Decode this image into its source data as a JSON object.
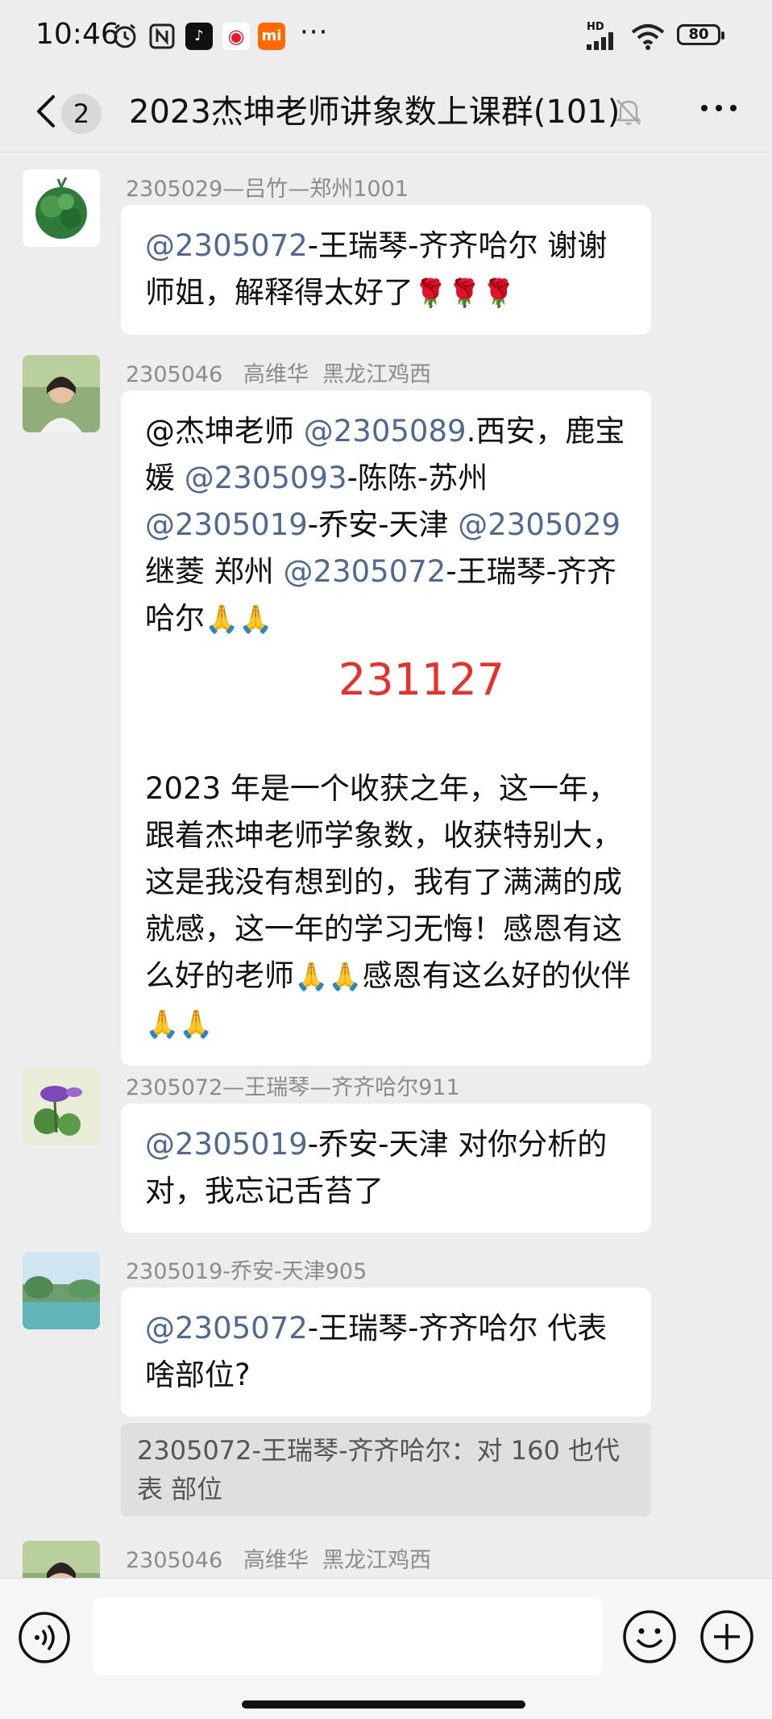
{
  "status_bar": {
    "time": "10:46",
    "app_icons": [
      "alarm-icon",
      "nfc-icon",
      "tiktok-icon",
      "weibo-icon",
      "mi-icon"
    ],
    "more": "···",
    "network": "HD",
    "battery": "80"
  },
  "header": {
    "unread_count": "2",
    "title": "2023杰坤老师讲象数上课群(101)"
  },
  "messages": [
    {
      "sender": "2305029—吕竹—郑州1001",
      "mention": "@2305072",
      "text": "-王瑞琴-齐齐哈尔  谢谢师姐，解释得太好了",
      "emoji": "🌹🌹🌹"
    },
    {
      "sender": "2305046   高维华  黑龙江鸡西",
      "m1_mention": "@杰坤老师",
      "m2_mention": "@2305089",
      "m2_text": ".西安，鹿宝媛",
      "m3_mention": "@2305093",
      "m3_text": "-陈陈-苏州",
      "m4_mention": "@2305019",
      "m4_text": "-乔安-天津",
      "m5_mention": "@2305029",
      "m5_text": "继菱  郑州",
      "m6_mention": "@2305072",
      "m6_text": "-王瑞琴-齐齐哈尔",
      "emoji1": "🙏🙏",
      "big_number": "231127",
      "para1": "2023 年是一个收获之年，这一年，跟着杰坤老师学象数，收获特别大，这是我没有想到的，我有了满满的成就感，这一年的学习无悔！感恩有这么好的老师",
      "emoji2": "🙏🙏",
      "para2": "感恩有这么好的伙伴",
      "emoji3": "🙏🙏"
    },
    {
      "sender": "2305072—王瑞琴—齐齐哈尔911",
      "mention": "@2305019",
      "text": "-乔安-天津  对你分析的对，我忘记舌苔了"
    },
    {
      "sender": "2305019-乔安-天津905",
      "mention": "@2305072",
      "text": "-王瑞琴-齐齐哈尔  代表啥部位?",
      "quote": "2305072-王瑞琴-齐齐哈尔：对 160 也代表 部位"
    },
    {
      "sender": "2305046   高维华  黑龙江鸡西"
    }
  ],
  "input_bar": {
    "voice_icon": "voice-icon",
    "emoji_icon": "smiley-icon",
    "plus_icon": "plus-icon",
    "placeholder": ""
  },
  "colors": {
    "background": "#ededed",
    "bubble": "#ffffff",
    "mention": "#4e6994",
    "highlight_red": "#e8312a"
  }
}
